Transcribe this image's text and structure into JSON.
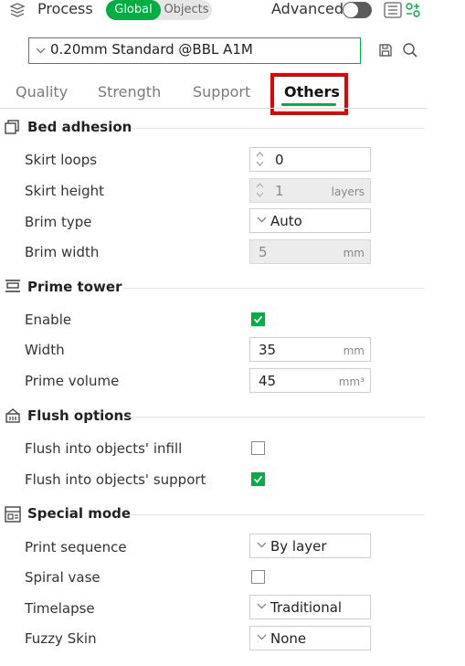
{
  "header": {
    "title": "Process",
    "toggle_global": "Global",
    "toggle_objects": "Objects",
    "advanced_label": "Advanced",
    "advanced_on": false
  },
  "preset": {
    "name": "0.20mm Standard @BBL A1M"
  },
  "tabs": [
    {
      "label": "Quality",
      "active": false
    },
    {
      "label": "Strength",
      "active": false
    },
    {
      "label": "Support",
      "active": false
    },
    {
      "label": "Others",
      "active": true
    }
  ],
  "sections": {
    "bed_adhesion": {
      "title": "Bed adhesion",
      "skirt_loops": {
        "label": "Skirt loops",
        "value": "0"
      },
      "skirt_height": {
        "label": "Skirt height",
        "value": "1",
        "unit": "layers"
      },
      "brim_type": {
        "label": "Brim type",
        "value": "Auto"
      },
      "brim_width": {
        "label": "Brim width",
        "value": "5",
        "unit": "mm"
      }
    },
    "prime_tower": {
      "title": "Prime tower",
      "enable": {
        "label": "Enable",
        "checked": true
      },
      "width": {
        "label": "Width",
        "value": "35",
        "unit": "mm"
      },
      "prime_volume": {
        "label": "Prime volume",
        "value": "45",
        "unit": "mm³"
      }
    },
    "flush_options": {
      "title": "Flush options",
      "flush_infill": {
        "label": "Flush into objects' infill",
        "checked": false
      },
      "flush_support": {
        "label": "Flush into objects' support",
        "checked": true
      }
    },
    "special_mode": {
      "title": "Special mode",
      "print_sequence": {
        "label": "Print sequence",
        "value": "By layer"
      },
      "spiral_vase": {
        "label": "Spiral vase",
        "checked": false
      },
      "timelapse": {
        "label": "Timelapse",
        "value": "Traditional"
      },
      "fuzzy_skin": {
        "label": "Fuzzy Skin",
        "value": "None"
      }
    }
  },
  "colors": {
    "accent": "#00ae42",
    "highlight": "#e30000"
  }
}
